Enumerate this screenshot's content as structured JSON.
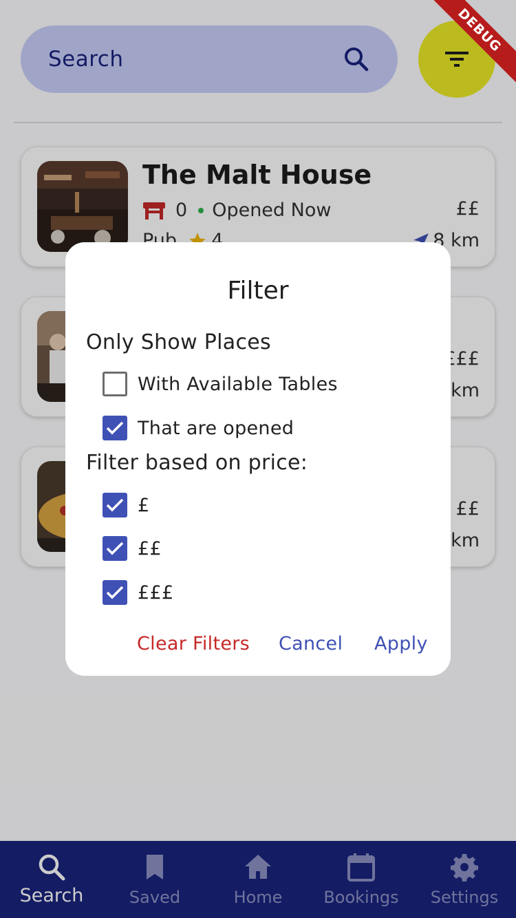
{
  "search": {
    "placeholder": "Search"
  },
  "debug_banner": "DEBUG",
  "cards": [
    {
      "title": "The Malt House",
      "tables": "0",
      "status": "Opened Now",
      "price": "££",
      "type": "Pub",
      "rating": "4",
      "distance": "8 km"
    },
    {
      "price": "£££",
      "distance": "km"
    },
    {
      "price": "££",
      "distance": "km"
    }
  ],
  "dialog": {
    "title": "Filter",
    "section_places": "Only Show Places",
    "option_tables": "With Available Tables",
    "option_opened": "That are opened",
    "section_price": "Filter based on price:",
    "price_1": "£",
    "price_2": "££",
    "price_3": "£££",
    "clear_label": "Clear Filters",
    "cancel_label": "Cancel",
    "apply_label": "Apply"
  },
  "nav": {
    "search": "Search",
    "saved": "Saved",
    "home": "Home",
    "bookings": "Bookings",
    "settings": "Settings"
  },
  "colors": {
    "primary": "#3f51b5",
    "nav_bg": "#1a237e",
    "search_bg": "#c8cffa",
    "fab": "#eaea27",
    "danger": "#c62828",
    "open_dot": "#2bb34a"
  }
}
